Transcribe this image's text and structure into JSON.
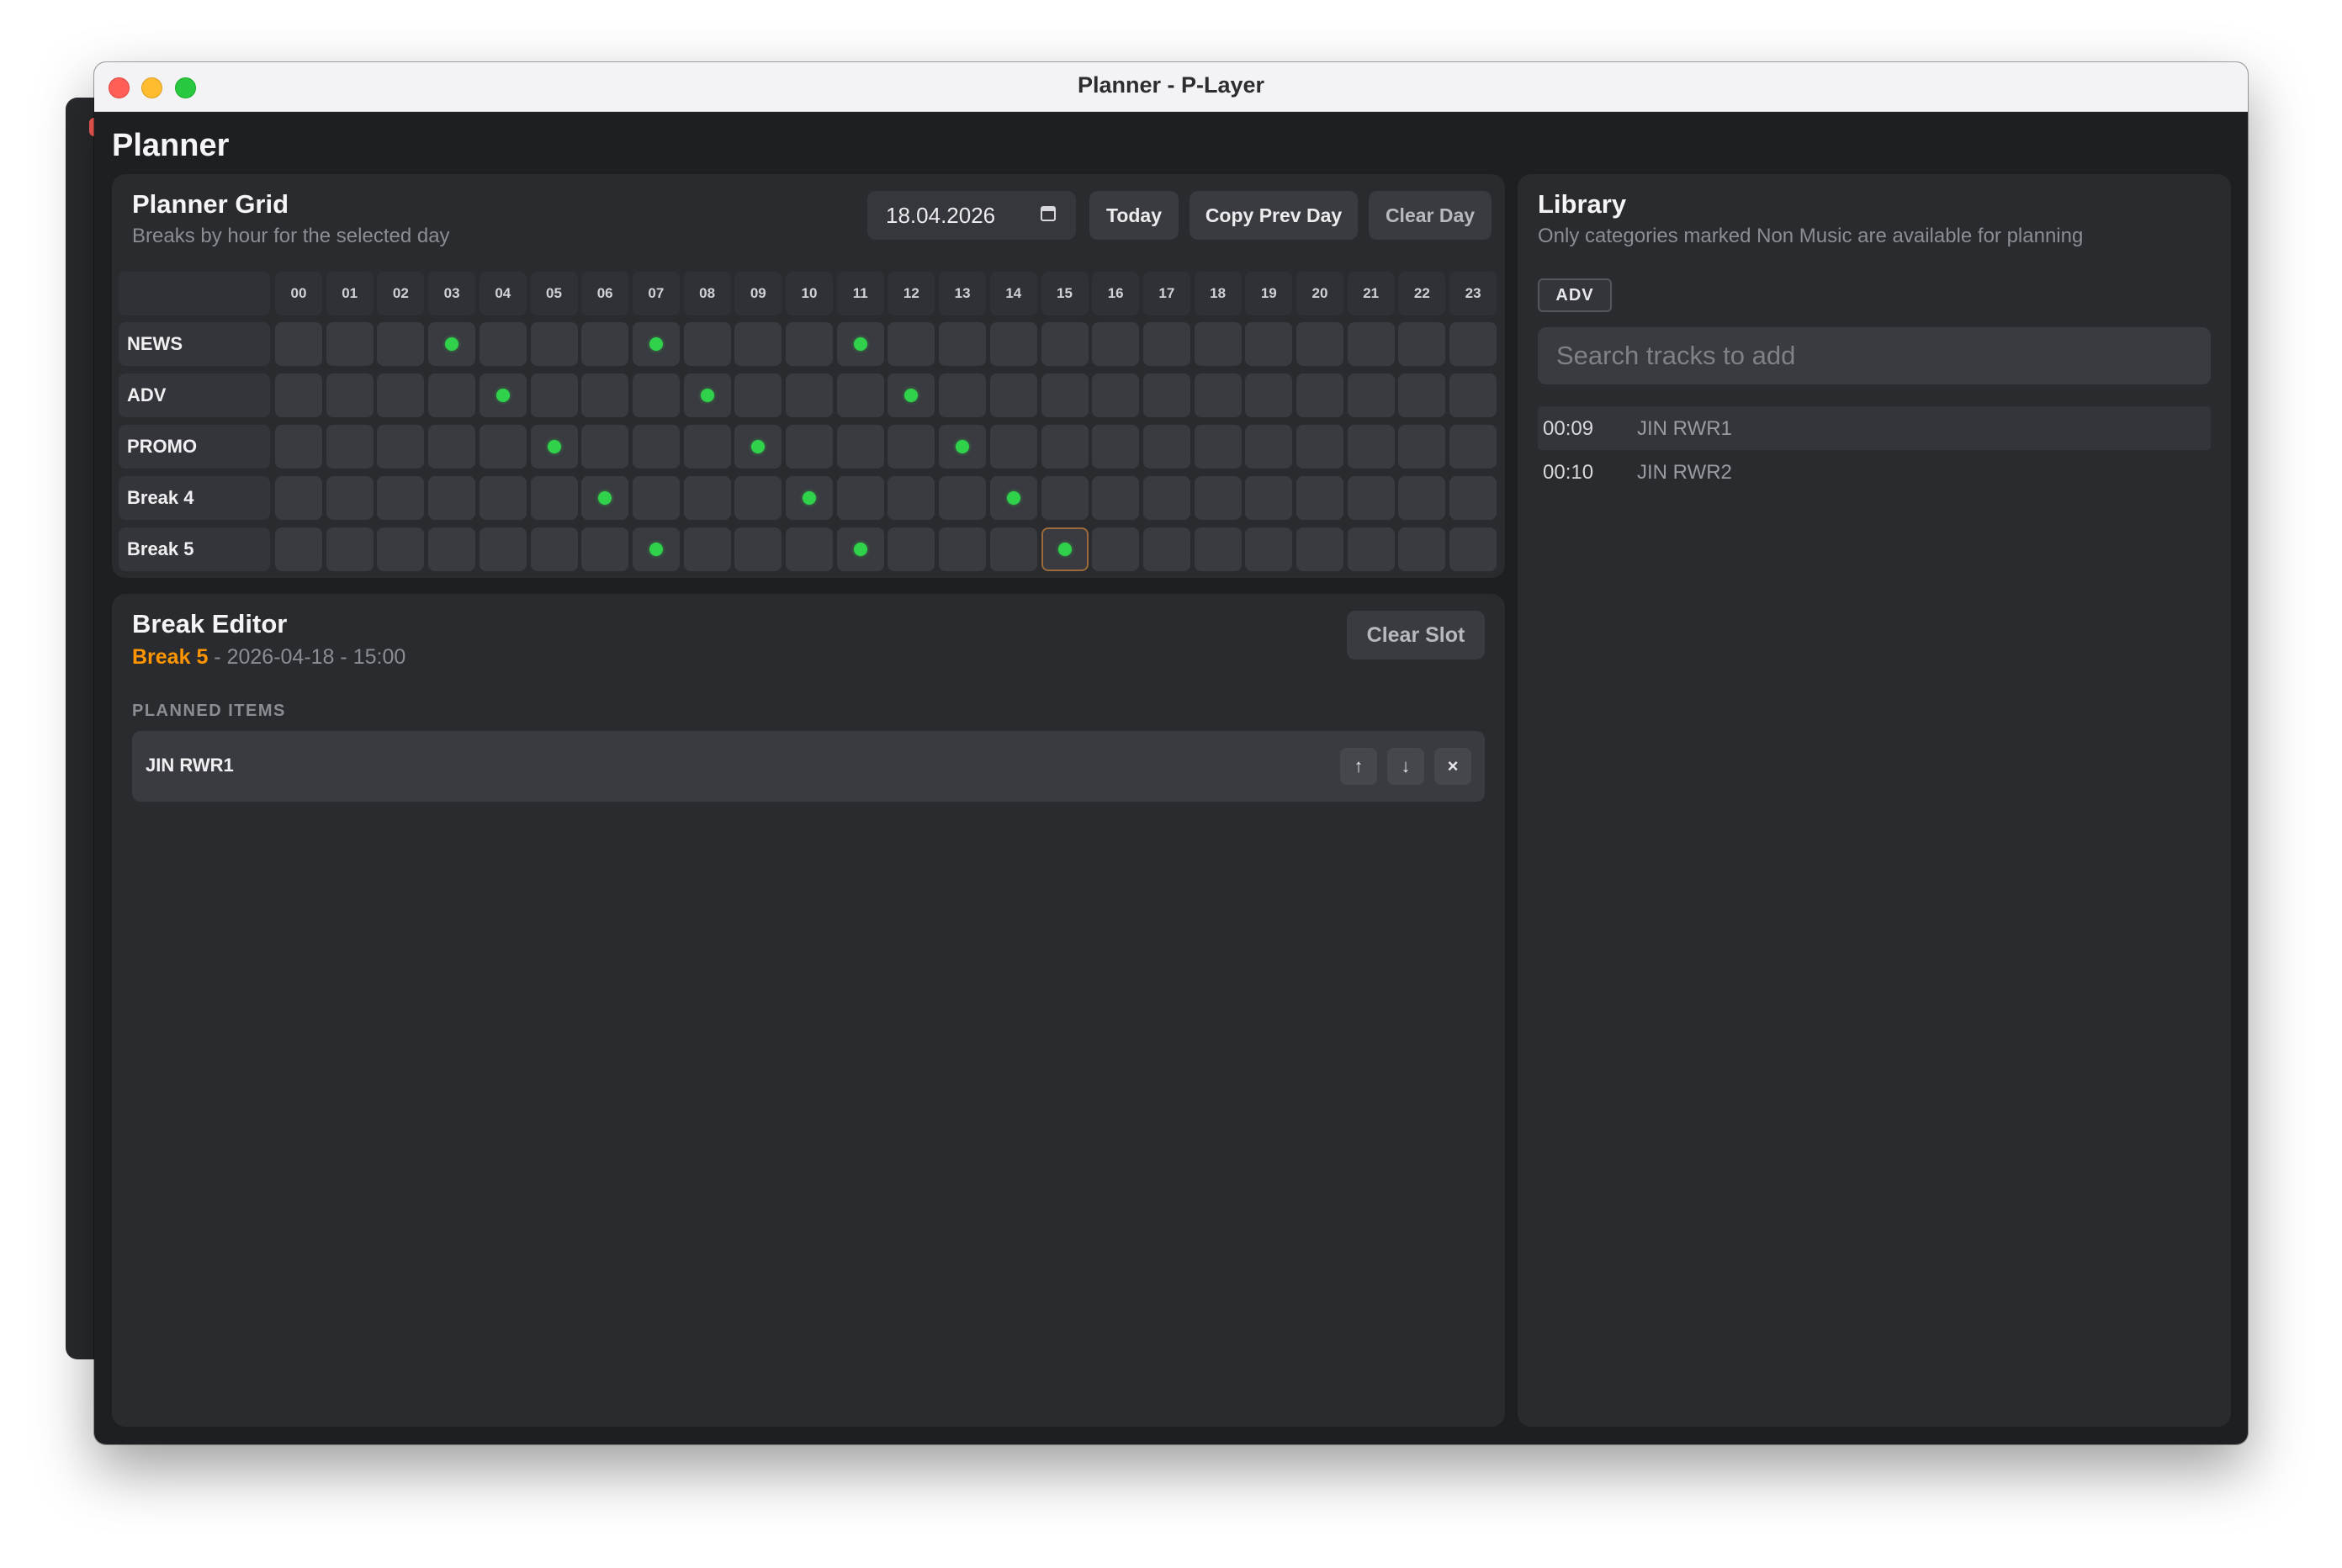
{
  "window": {
    "title": "Planner - P-Layer"
  },
  "app": {
    "title": "Planner"
  },
  "grid_panel": {
    "title": "Planner Grid",
    "subtitle": "Breaks by hour for the selected day",
    "date_value": "18.04.2026",
    "buttons": {
      "today": "Today",
      "copy_prev_day": "Copy Prev Day",
      "clear_day": "Clear Day"
    },
    "hours": [
      "00",
      "01",
      "02",
      "03",
      "04",
      "05",
      "06",
      "07",
      "08",
      "09",
      "10",
      "11",
      "12",
      "13",
      "14",
      "15",
      "16",
      "17",
      "18",
      "19",
      "20",
      "21",
      "22",
      "23"
    ],
    "rows": [
      {
        "label": "NEWS",
        "planned_hours": [
          3,
          7,
          11
        ]
      },
      {
        "label": "ADV",
        "planned_hours": [
          4,
          8,
          12
        ]
      },
      {
        "label": "PROMO",
        "planned_hours": [
          5,
          9,
          13
        ]
      },
      {
        "label": "Break 4",
        "planned_hours": [
          6,
          10,
          14
        ]
      },
      {
        "label": "Break 5",
        "planned_hours": [
          7,
          11,
          15
        ]
      }
    ],
    "selected": {
      "row": 4,
      "hour": 15
    },
    "colors": {
      "planned_dot": "#2fd24a",
      "selected_border": "#9a6a3a"
    }
  },
  "editor_panel": {
    "title": "Break Editor",
    "break_name": "Break 5",
    "separator": " - ",
    "date": "2026-04-18",
    "time": "15:00",
    "clear_slot": "Clear Slot",
    "section_label": "PLANNED ITEMS",
    "items": [
      {
        "name": "JIN RWR1",
        "icons": [
          "arrow-up-icon",
          "arrow-down-icon",
          "close-icon"
        ]
      }
    ],
    "colors": {
      "break_name": "#ff9500"
    }
  },
  "library_panel": {
    "title": "Library",
    "subtitle": "Only categories marked Non Music are available for planning",
    "category_tag": "ADV",
    "search_placeholder": "Search tracks to add",
    "tracks": [
      {
        "duration": "00:09",
        "name": "JIN RWR1"
      },
      {
        "duration": "00:10",
        "name": "JIN RWR2"
      }
    ]
  }
}
